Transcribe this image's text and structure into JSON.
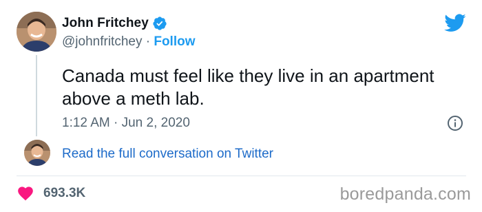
{
  "tweet": {
    "author": {
      "display_name": "John Fritchey",
      "handle": "@johnfritchey",
      "verified": true
    },
    "separator": "·",
    "follow_label": "Follow",
    "text": "Canada must feel like they live in an apartment above a meth lab.",
    "timestamp": "1:12 AM · Jun 2, 2020",
    "read_more_label": "Read the full conversation on Twitter",
    "like_count": "693.3K"
  },
  "watermark": "boredpanda.com",
  "icons": {
    "brand": "twitter-logo-icon",
    "verified": "verified-badge-icon",
    "info": "info-icon",
    "like": "heart-icon"
  },
  "colors": {
    "brand_blue": "#1d9bf0",
    "link_blue": "#1d6bc9",
    "text_primary": "#0f1419",
    "text_secondary": "#536471",
    "like_pink": "#f91880",
    "divider": "#e1e8ed"
  }
}
